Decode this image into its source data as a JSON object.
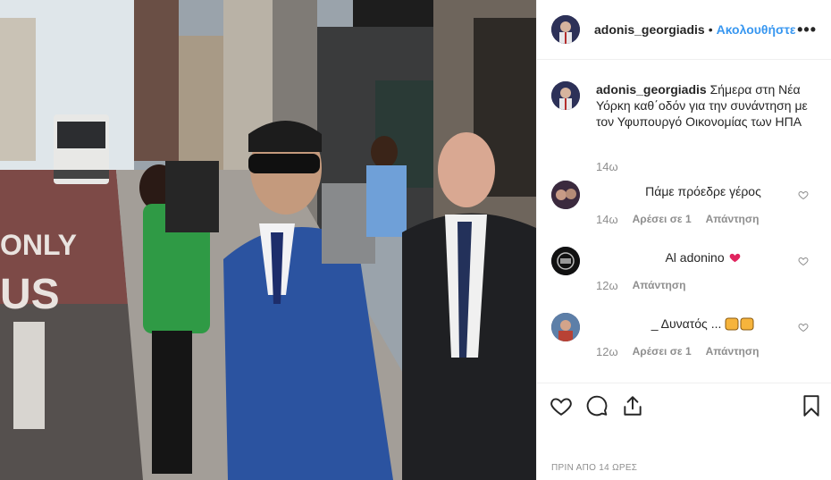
{
  "post": {
    "author": "adonis_georgiadis",
    "separator": "•",
    "follow_label": "Ακολουθήστε",
    "more_label": "•••",
    "caption": "Σήμερα στη Νέα Υόρκη καθ΄οδόν για την συνάντηση με τον Υφυπουργό Οικονομίας των ΗΠΑ",
    "caption_time": "14ω",
    "timestamp": "ΠΡΙΝ ΑΠΟ 14 ΩΡΕΣ"
  },
  "photo": {
    "street_text_1": "ONLY",
    "street_text_2": "US"
  },
  "comments": [
    {
      "text": "Πάμε πρόεδρε γέρος",
      "time": "14ω",
      "likes_label": "Αρέσει σε 1",
      "reply_label": "Απάντηση"
    },
    {
      "text": "Al adonino",
      "time": "12ω",
      "likes_label": "",
      "reply_label": "Απάντηση"
    },
    {
      "text": "_ Δυνατός ...",
      "time": "12ω",
      "likes_label": "Αρέσει σε 1",
      "reply_label": "Απάντηση"
    }
  ],
  "icons": {
    "like": "heart-icon",
    "comment": "comment-bubble-icon",
    "share": "share-icon",
    "save": "bookmark-icon"
  },
  "colors": {
    "link": "#3897f0",
    "muted": "#8e8e8e",
    "text": "#262626",
    "heart_red": "#e0245e"
  }
}
